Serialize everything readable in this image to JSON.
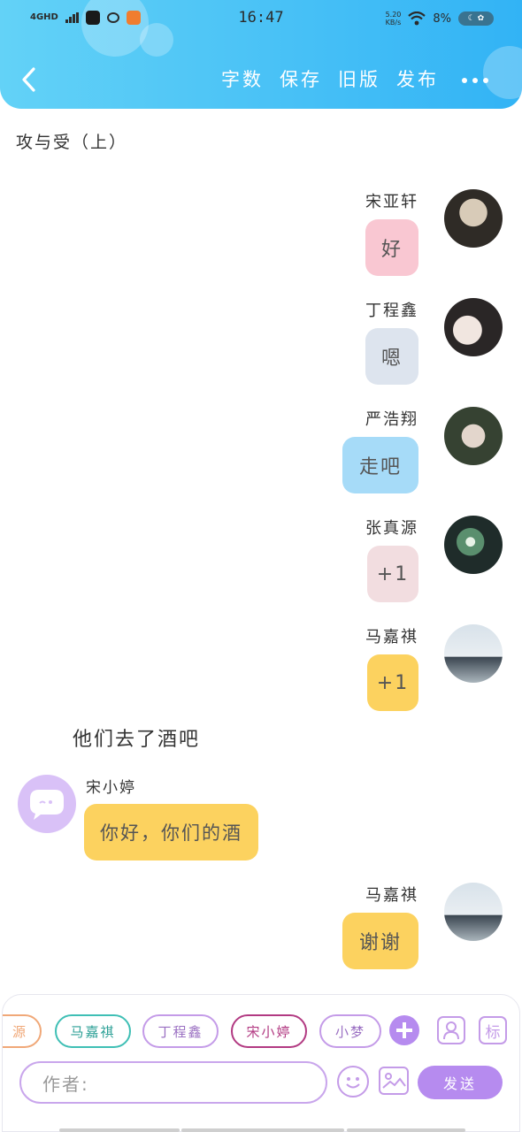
{
  "status_bar": {
    "network": "4GHD",
    "time": "16:47",
    "speed_value": "5.20",
    "speed_unit": "KB/s",
    "battery_percent": "8%"
  },
  "toolbar": {
    "word_count": "字数",
    "save": "保存",
    "old_version": "旧版",
    "publish": "发布"
  },
  "doc_title": "攻与受（上）",
  "messages_right": [
    {
      "name": "宋亚轩",
      "text": "好",
      "bubble_color": "#f9c7d2"
    },
    {
      "name": "丁程鑫",
      "text": "嗯",
      "bubble_color": "#dde4ee"
    },
    {
      "name": "严浩翔",
      "text": "走吧",
      "bubble_color": "#a6dbf8"
    },
    {
      "name": "张真源",
      "text": "+1",
      "bubble_color": "#f2dde0"
    },
    {
      "name": "马嘉祺",
      "text": "+1",
      "bubble_color": "#fcd25f"
    }
  ],
  "narration": "他们去了酒吧",
  "message_left": {
    "name": "宋小婷",
    "text": "你好，你们的酒",
    "bubble_color": "#fcd25f"
  },
  "message_last": {
    "name": "马嘉祺",
    "text": "谢谢",
    "bubble_color": "#fcd25f"
  },
  "composer": {
    "chips": [
      {
        "label": "源",
        "color": "#f0a878"
      },
      {
        "label": "马嘉祺",
        "color": "#3fbfb5"
      },
      {
        "label": "丁程鑫",
        "color": "#c49be8"
      },
      {
        "label": "宋小婷",
        "color": "#b23a82"
      },
      {
        "label": "小梦",
        "color": "#c49be8"
      }
    ],
    "tag_button": "标",
    "author_placeholder": "作者:",
    "send": "发送"
  }
}
